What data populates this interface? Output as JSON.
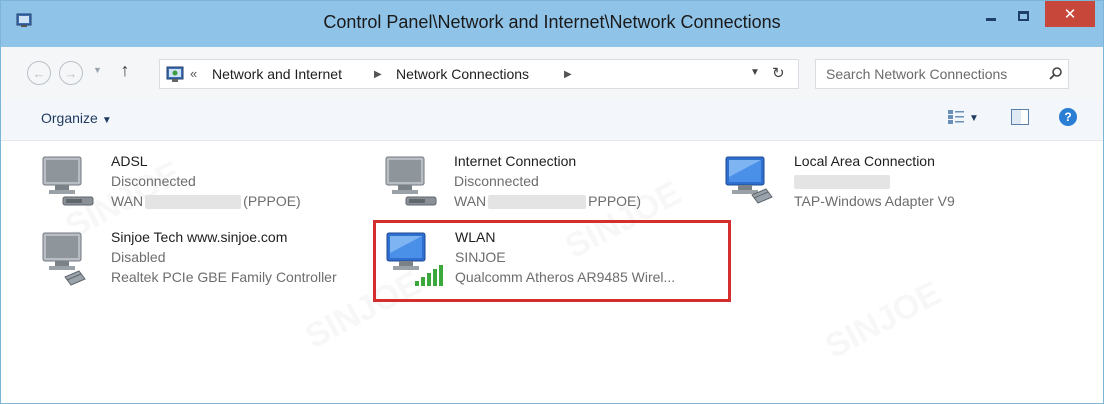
{
  "window": {
    "title": "Control Panel\\Network and Internet\\Network Connections",
    "close_glyph": "✕"
  },
  "address": {
    "overflow_glyph": "«",
    "breadcrumbs": [
      "Network and Internet",
      "Network Connections"
    ],
    "search_placeholder": "Search Network Connections"
  },
  "toolbar": {
    "organize_label": "Organize",
    "help_glyph": "?"
  },
  "connections": [
    {
      "name": "ADSL",
      "status": "Disconnected",
      "device_prefix": "WAN",
      "device_suffix": "(PPPOE)",
      "icon": "dialup-connection-icon"
    },
    {
      "name": "Internet Connection",
      "status": "Disconnected",
      "device_prefix": "WAN",
      "device_suffix": "PPPOE)",
      "icon": "dialup-connection-icon"
    },
    {
      "name": "Local Area Connection",
      "status": "",
      "device": "TAP-Windows Adapter V9",
      "icon": "ethernet-adapter-icon"
    },
    {
      "name": "Sinjoe Tech www.sinjoe.com",
      "status": "Disabled",
      "device": "Realtek PCIe GBE Family Controller",
      "icon": "ethernet-adapter-disabled-icon"
    },
    {
      "name": "WLAN",
      "status": "SINJOE",
      "device": "Qualcomm Atheros AR9485 Wirel...",
      "icon": "wireless-adapter-icon",
      "selected": true
    }
  ],
  "watermark_text": "SINJOE",
  "colors": {
    "titlebar": "#8fc3e8",
    "close_button": "#c7483a",
    "highlight_border": "#d32f2f",
    "link_text": "#1e3a5f"
  }
}
